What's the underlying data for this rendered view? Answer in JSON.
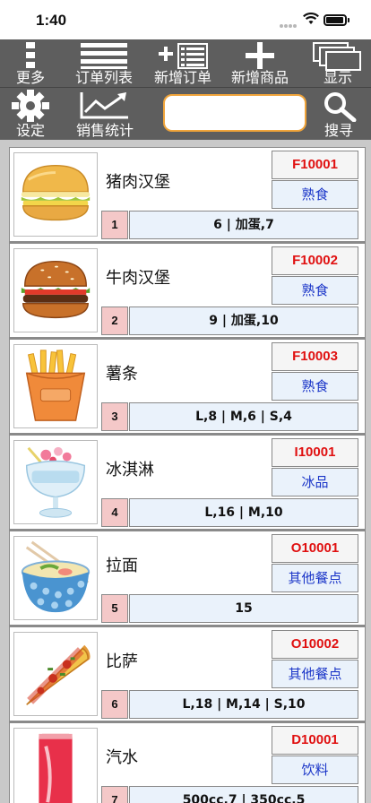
{
  "status_bar": {
    "time": "1:40"
  },
  "toolbar_top": [
    {
      "label": "更多",
      "icon": "more-icon"
    },
    {
      "label": "订单列表",
      "icon": "list-icon"
    },
    {
      "label": "新增订单",
      "icon": "add-order-icon"
    },
    {
      "label": "新增商品",
      "icon": "plus-icon"
    },
    {
      "label": "显示",
      "icon": "windows-icon"
    }
  ],
  "toolbar_bottom": {
    "settings_label": "设定",
    "stats_label": "销售统计",
    "search_value": "",
    "search_label": "搜寻"
  },
  "products": [
    {
      "name": "猪肉汉堡",
      "code": "F10001",
      "category": "熟食",
      "index": "1",
      "spec": "6 | 加蛋,7",
      "image": "hamburger-plain"
    },
    {
      "name": "牛肉汉堡",
      "code": "F10002",
      "category": "熟食",
      "index": "2",
      "spec": "9 | 加蛋,10",
      "image": "hamburger-beef"
    },
    {
      "name": "薯条",
      "code": "F10003",
      "category": "熟食",
      "index": "3",
      "spec": "L,8 | M,6 | S,4",
      "image": "fries"
    },
    {
      "name": "冰淇淋",
      "code": "I10001",
      "category": "冰品",
      "index": "4",
      "spec": "L,16 | M,10",
      "image": "ice-cream"
    },
    {
      "name": "拉面",
      "code": "O10001",
      "category": "其他餐点",
      "index": "5",
      "spec": "15",
      "image": "ramen"
    },
    {
      "name": "比萨",
      "code": "O10002",
      "category": "其他餐点",
      "index": "6",
      "spec": "L,18 | M,14 | S,10",
      "image": "pizza"
    },
    {
      "name": "汽水",
      "code": "D10001",
      "category": "饮料",
      "index": "7",
      "spec": "500cc,7 | 350cc,5",
      "image": "soda"
    }
  ]
}
